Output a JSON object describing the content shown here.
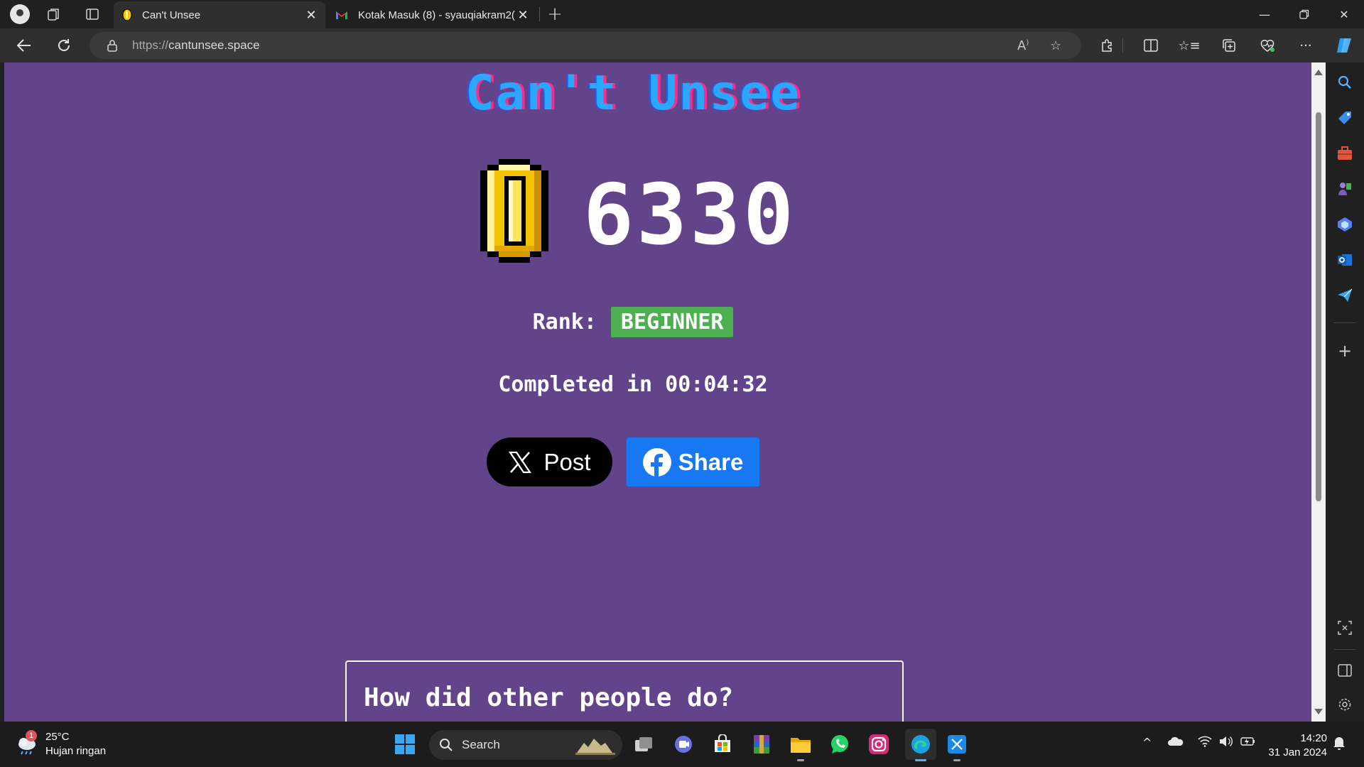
{
  "browser": {
    "tabs": [
      {
        "title": "Can't Unsee",
        "active": true
      },
      {
        "title": "Kotak Masuk (8) - syauqiakram2(",
        "active": false
      }
    ],
    "url_protocol": "https://",
    "url_host": "cantunsee.space"
  },
  "page": {
    "site_title": "Can't Unsee",
    "score": "6330",
    "rank_label": "Rank:",
    "rank_value": "BEGINNER",
    "completed_text": "Completed in 00:04:32",
    "post_button": "Post",
    "share_button": "Share",
    "stats_title": "How did other people do?"
  },
  "taskbar": {
    "weather_badge": "1",
    "temperature": "25°C",
    "condition": "Hujan ringan",
    "search_placeholder": "Search",
    "time": "14:20",
    "date": "31 Jan 2024"
  },
  "colors": {
    "page_bg": "#62448b",
    "rank_badge": "#4caf50",
    "share_blue": "#1877f2",
    "title_cyan": "#2aa7ff",
    "title_magenta": "#ff2a8c"
  }
}
